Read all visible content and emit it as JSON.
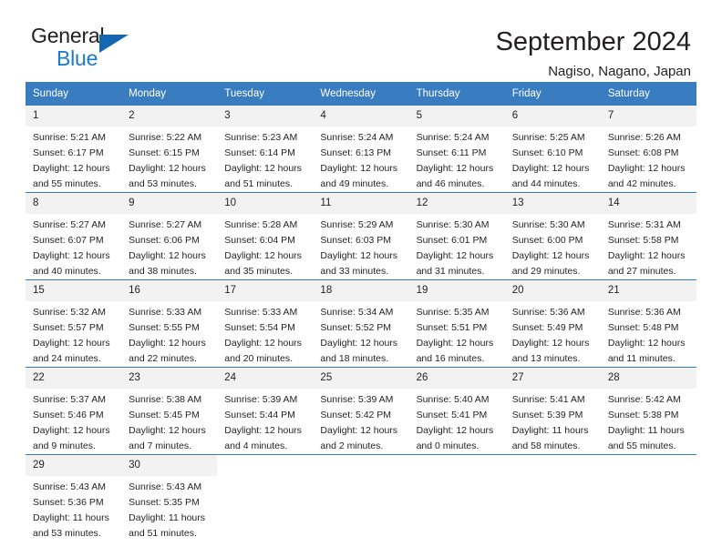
{
  "brand": {
    "name_part1": "General",
    "name_part2": "Blue",
    "triangle_color": "#1567b3",
    "blue_color": "#1b79c9"
  },
  "header": {
    "title": "September 2024",
    "subtitle": "Nagiso, Nagano, Japan"
  },
  "theme": {
    "header_bg": "#3a7cc0",
    "day_number_bg": "#f2f2f2",
    "text_color": "#231f20"
  },
  "weekdays": [
    "Sunday",
    "Monday",
    "Tuesday",
    "Wednesday",
    "Thursday",
    "Friday",
    "Saturday"
  ],
  "weeks": [
    [
      {
        "day": "1",
        "sunrise": "Sunrise: 5:21 AM",
        "sunset": "Sunset: 6:17 PM",
        "daylight1": "Daylight: 12 hours",
        "daylight2": "and 55 minutes."
      },
      {
        "day": "2",
        "sunrise": "Sunrise: 5:22 AM",
        "sunset": "Sunset: 6:15 PM",
        "daylight1": "Daylight: 12 hours",
        "daylight2": "and 53 minutes."
      },
      {
        "day": "3",
        "sunrise": "Sunrise: 5:23 AM",
        "sunset": "Sunset: 6:14 PM",
        "daylight1": "Daylight: 12 hours",
        "daylight2": "and 51 minutes."
      },
      {
        "day": "4",
        "sunrise": "Sunrise: 5:24 AM",
        "sunset": "Sunset: 6:13 PM",
        "daylight1": "Daylight: 12 hours",
        "daylight2": "and 49 minutes."
      },
      {
        "day": "5",
        "sunrise": "Sunrise: 5:24 AM",
        "sunset": "Sunset: 6:11 PM",
        "daylight1": "Daylight: 12 hours",
        "daylight2": "and 46 minutes."
      },
      {
        "day": "6",
        "sunrise": "Sunrise: 5:25 AM",
        "sunset": "Sunset: 6:10 PM",
        "daylight1": "Daylight: 12 hours",
        "daylight2": "and 44 minutes."
      },
      {
        "day": "7",
        "sunrise": "Sunrise: 5:26 AM",
        "sunset": "Sunset: 6:08 PM",
        "daylight1": "Daylight: 12 hours",
        "daylight2": "and 42 minutes."
      }
    ],
    [
      {
        "day": "8",
        "sunrise": "Sunrise: 5:27 AM",
        "sunset": "Sunset: 6:07 PM",
        "daylight1": "Daylight: 12 hours",
        "daylight2": "and 40 minutes."
      },
      {
        "day": "9",
        "sunrise": "Sunrise: 5:27 AM",
        "sunset": "Sunset: 6:06 PM",
        "daylight1": "Daylight: 12 hours",
        "daylight2": "and 38 minutes."
      },
      {
        "day": "10",
        "sunrise": "Sunrise: 5:28 AM",
        "sunset": "Sunset: 6:04 PM",
        "daylight1": "Daylight: 12 hours",
        "daylight2": "and 35 minutes."
      },
      {
        "day": "11",
        "sunrise": "Sunrise: 5:29 AM",
        "sunset": "Sunset: 6:03 PM",
        "daylight1": "Daylight: 12 hours",
        "daylight2": "and 33 minutes."
      },
      {
        "day": "12",
        "sunrise": "Sunrise: 5:30 AM",
        "sunset": "Sunset: 6:01 PM",
        "daylight1": "Daylight: 12 hours",
        "daylight2": "and 31 minutes."
      },
      {
        "day": "13",
        "sunrise": "Sunrise: 5:30 AM",
        "sunset": "Sunset: 6:00 PM",
        "daylight1": "Daylight: 12 hours",
        "daylight2": "and 29 minutes."
      },
      {
        "day": "14",
        "sunrise": "Sunrise: 5:31 AM",
        "sunset": "Sunset: 5:58 PM",
        "daylight1": "Daylight: 12 hours",
        "daylight2": "and 27 minutes."
      }
    ],
    [
      {
        "day": "15",
        "sunrise": "Sunrise: 5:32 AM",
        "sunset": "Sunset: 5:57 PM",
        "daylight1": "Daylight: 12 hours",
        "daylight2": "and 24 minutes."
      },
      {
        "day": "16",
        "sunrise": "Sunrise: 5:33 AM",
        "sunset": "Sunset: 5:55 PM",
        "daylight1": "Daylight: 12 hours",
        "daylight2": "and 22 minutes."
      },
      {
        "day": "17",
        "sunrise": "Sunrise: 5:33 AM",
        "sunset": "Sunset: 5:54 PM",
        "daylight1": "Daylight: 12 hours",
        "daylight2": "and 20 minutes."
      },
      {
        "day": "18",
        "sunrise": "Sunrise: 5:34 AM",
        "sunset": "Sunset: 5:52 PM",
        "daylight1": "Daylight: 12 hours",
        "daylight2": "and 18 minutes."
      },
      {
        "day": "19",
        "sunrise": "Sunrise: 5:35 AM",
        "sunset": "Sunset: 5:51 PM",
        "daylight1": "Daylight: 12 hours",
        "daylight2": "and 16 minutes."
      },
      {
        "day": "20",
        "sunrise": "Sunrise: 5:36 AM",
        "sunset": "Sunset: 5:49 PM",
        "daylight1": "Daylight: 12 hours",
        "daylight2": "and 13 minutes."
      },
      {
        "day": "21",
        "sunrise": "Sunrise: 5:36 AM",
        "sunset": "Sunset: 5:48 PM",
        "daylight1": "Daylight: 12 hours",
        "daylight2": "and 11 minutes."
      }
    ],
    [
      {
        "day": "22",
        "sunrise": "Sunrise: 5:37 AM",
        "sunset": "Sunset: 5:46 PM",
        "daylight1": "Daylight: 12 hours",
        "daylight2": "and 9 minutes."
      },
      {
        "day": "23",
        "sunrise": "Sunrise: 5:38 AM",
        "sunset": "Sunset: 5:45 PM",
        "daylight1": "Daylight: 12 hours",
        "daylight2": "and 7 minutes."
      },
      {
        "day": "24",
        "sunrise": "Sunrise: 5:39 AM",
        "sunset": "Sunset: 5:44 PM",
        "daylight1": "Daylight: 12 hours",
        "daylight2": "and 4 minutes."
      },
      {
        "day": "25",
        "sunrise": "Sunrise: 5:39 AM",
        "sunset": "Sunset: 5:42 PM",
        "daylight1": "Daylight: 12 hours",
        "daylight2": "and 2 minutes."
      },
      {
        "day": "26",
        "sunrise": "Sunrise: 5:40 AM",
        "sunset": "Sunset: 5:41 PM",
        "daylight1": "Daylight: 12 hours",
        "daylight2": "and 0 minutes."
      },
      {
        "day": "27",
        "sunrise": "Sunrise: 5:41 AM",
        "sunset": "Sunset: 5:39 PM",
        "daylight1": "Daylight: 11 hours",
        "daylight2": "and 58 minutes."
      },
      {
        "day": "28",
        "sunrise": "Sunrise: 5:42 AM",
        "sunset": "Sunset: 5:38 PM",
        "daylight1": "Daylight: 11 hours",
        "daylight2": "and 55 minutes."
      }
    ],
    [
      {
        "day": "29",
        "sunrise": "Sunrise: 5:43 AM",
        "sunset": "Sunset: 5:36 PM",
        "daylight1": "Daylight: 11 hours",
        "daylight2": "and 53 minutes."
      },
      {
        "day": "30",
        "sunrise": "Sunrise: 5:43 AM",
        "sunset": "Sunset: 5:35 PM",
        "daylight1": "Daylight: 11 hours",
        "daylight2": "and 51 minutes."
      },
      {
        "day": "",
        "sunrise": "",
        "sunset": "",
        "daylight1": "",
        "daylight2": ""
      },
      {
        "day": "",
        "sunrise": "",
        "sunset": "",
        "daylight1": "",
        "daylight2": ""
      },
      {
        "day": "",
        "sunrise": "",
        "sunset": "",
        "daylight1": "",
        "daylight2": ""
      },
      {
        "day": "",
        "sunrise": "",
        "sunset": "",
        "daylight1": "",
        "daylight2": ""
      },
      {
        "day": "",
        "sunrise": "",
        "sunset": "",
        "daylight1": "",
        "daylight2": ""
      }
    ]
  ]
}
